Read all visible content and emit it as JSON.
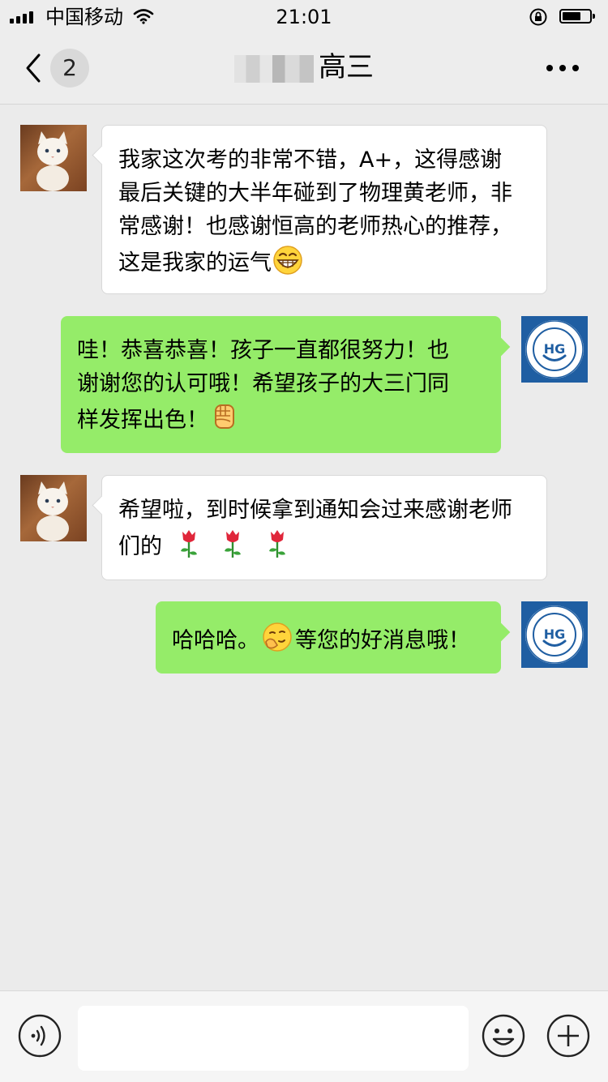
{
  "status_bar": {
    "carrier": "中国移动",
    "time": "21:01",
    "icons": [
      "signal-icon",
      "wifi-icon",
      "orientation-lock-icon",
      "battery-icon"
    ]
  },
  "nav": {
    "unread_count": "2",
    "title": "高三",
    "icons": [
      "back-chevron-icon",
      "more-icon"
    ]
  },
  "messages": [
    {
      "side": "left",
      "avatar": "kitten-avatar",
      "text": [
        "我家这次考的非常不错，A+，这得感谢",
        "最后关键的大半年碰到了物理黄老师，非",
        "常感谢！也感谢恒高的老师热心的推荐，",
        "这是我家的运气"
      ],
      "emoji": "grin-emoji"
    },
    {
      "side": "right",
      "avatar": "hg-logo-avatar",
      "text": [
        "哇！恭喜恭喜！孩子一直都很努力！也",
        "谢谢您的认可哦！希望孩子的大三门同",
        "样发挥出色！"
      ],
      "emoji": "fist-emoji"
    },
    {
      "side": "left",
      "avatar": "kitten-avatar",
      "text": [
        "希望啦，到时候拿到通知会过来感谢老师",
        "们的"
      ],
      "emoji": "rose-emoji"
    },
    {
      "side": "right",
      "avatar": "hg-logo-avatar",
      "text": [
        "哈哈哈。",
        "等您的好消息哦！"
      ],
      "emoji": "smirk-emoji"
    }
  ],
  "avatar_logo": {
    "letters": "HG"
  },
  "input_bar": {
    "icons": [
      "voice-icon",
      "emoji-icon",
      "plus-icon"
    ],
    "value": ""
  }
}
